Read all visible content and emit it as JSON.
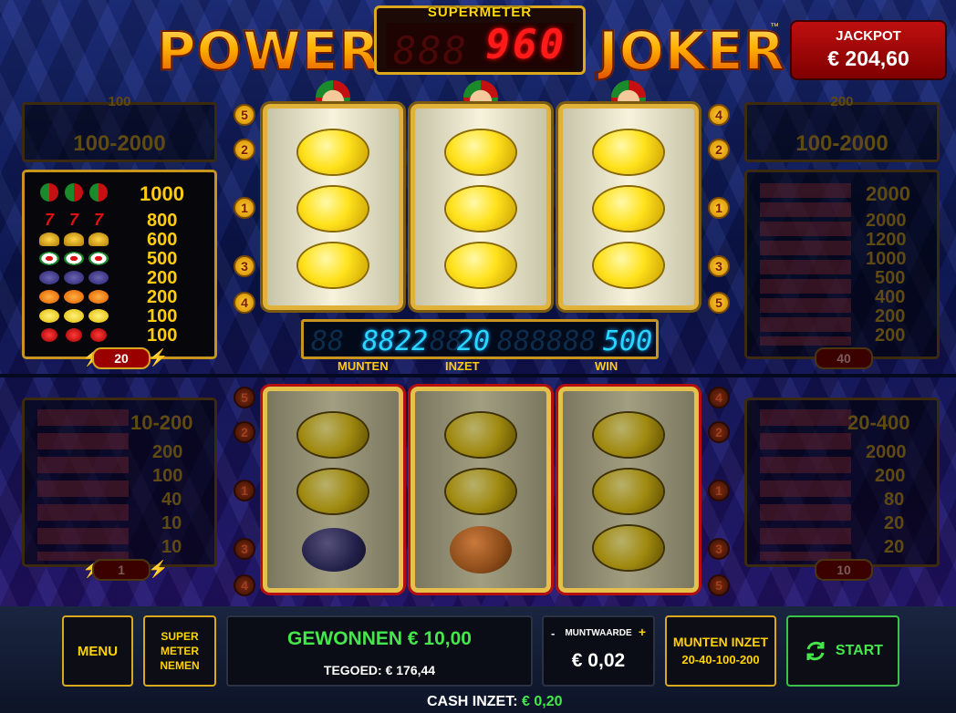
{
  "title": {
    "left": "POWER",
    "right": "JOKER",
    "tm": "™"
  },
  "supermeter": {
    "label": "SUPERMETER",
    "value": "960",
    "ghost": "888"
  },
  "jackpot": {
    "label": "JACKPOT",
    "amount": "€ 204,60"
  },
  "left_panel": {
    "top": {
      "number": "100",
      "range": "100-2000"
    },
    "main": {
      "joker_value": "1000",
      "rows": [
        "800",
        "600",
        "500",
        "200",
        "200",
        "100",
        "100"
      ],
      "badge": "20"
    },
    "bottom": {
      "joker_value": "10-200",
      "rows": [
        "200",
        "100",
        "40",
        "10",
        "10"
      ],
      "badge": "1"
    }
  },
  "right_panel": {
    "top": {
      "number": "200",
      "range": "100-2000"
    },
    "main": {
      "joker_value": "2000",
      "rows": [
        "2000",
        "1200",
        "1000",
        "500",
        "400",
        "200",
        "200"
      ],
      "badge": "40"
    },
    "bottom": {
      "joker_value": "20-400",
      "rows": [
        "2000",
        "200",
        "80",
        "20",
        "20"
      ],
      "badge": "10"
    }
  },
  "line_markers": {
    "left_top": [
      "5",
      "2",
      "1",
      "3",
      "4"
    ],
    "right_top": [
      "4",
      "2",
      "1",
      "3",
      "5"
    ],
    "left_bot": [
      "5",
      "2",
      "1",
      "3",
      "4"
    ],
    "right_bot": [
      "4",
      "2",
      "1",
      "3",
      "5"
    ]
  },
  "counter": {
    "munten": "8822",
    "inzet": "20",
    "win": "500",
    "labels": {
      "munten": "MUNTEN",
      "inzet": "INZET",
      "win": "WIN"
    }
  },
  "bottom_bar": {
    "menu": "MENU",
    "super_meter": [
      "SUPER",
      "METER",
      "NEMEN"
    ],
    "won": "GEWONNEN € 10,00",
    "credit": "TEGOED: € 176,44",
    "coin_label": "MUNTWAARDE",
    "coin_minus": "-",
    "coin_plus": "+",
    "coin_value": "€ 0,02",
    "bet_title": "MUNTEN INZET",
    "bet_values": "20-40-100-200",
    "start": "START",
    "cash_label": "CASH INZET:",
    "cash_value": "€ 0,20"
  },
  "colors": {
    "gold": "#ffcc12",
    "green": "#44e84a",
    "red": "#ff1a1a",
    "cyan": "#28d7ff"
  }
}
